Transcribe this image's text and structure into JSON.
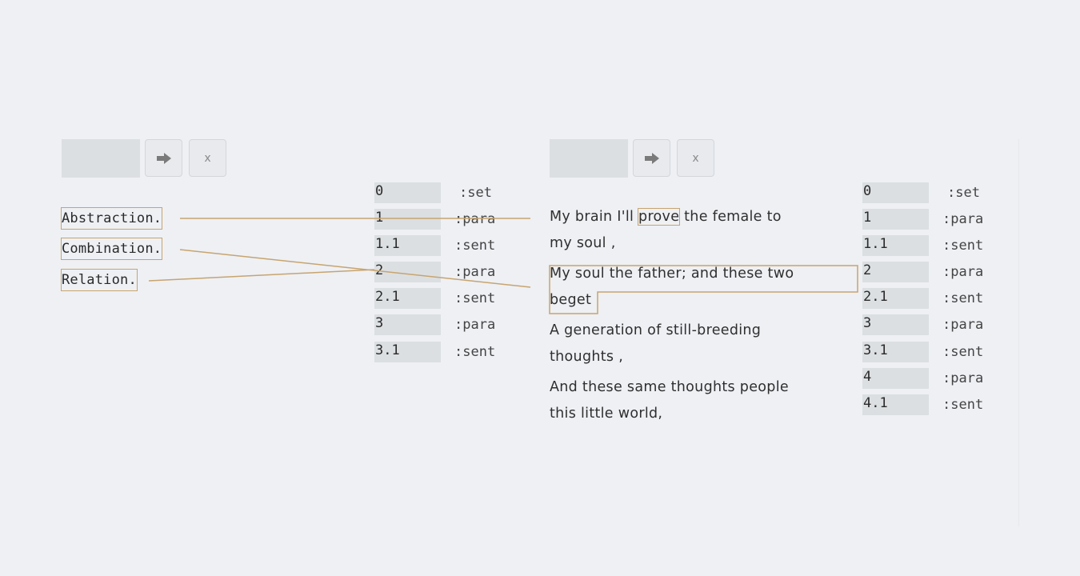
{
  "left_panel": {
    "toolbar": {
      "go_icon": "arrow-right-icon",
      "close_label": "x"
    },
    "words": [
      "Abstraction.",
      "Combination.",
      "Relation."
    ],
    "segments": [
      {
        "id": "0",
        "type": ":set"
      },
      {
        "id": "1",
        "type": ":para"
      },
      {
        "id": "1.1",
        "type": ":sent"
      },
      {
        "id": "2",
        "type": ":para"
      },
      {
        "id": "2.1",
        "type": ":sent"
      },
      {
        "id": "3",
        "type": ":para"
      },
      {
        "id": "3.1",
        "type": ":sent"
      }
    ]
  },
  "right_panel": {
    "toolbar": {
      "go_icon": "arrow-right-icon",
      "close_label": "x"
    },
    "text": {
      "p1_a": "My brain I'll ",
      "p1_hl": "prove",
      "p1_b": " the female to",
      "p1_c": "my soul ,",
      "p2_a": "My soul the father; and these two",
      "p2_b": "beget",
      "p3_a": "A generation of still-breeding",
      "p3_b": "thoughts ,",
      "p4_a": "And these same thoughts people",
      "p4_b": "this little world,"
    },
    "segments": [
      {
        "id": "0",
        "type": ":set"
      },
      {
        "id": "1",
        "type": ":para"
      },
      {
        "id": "1.1",
        "type": ":sent"
      },
      {
        "id": "2",
        "type": ":para"
      },
      {
        "id": "2.1",
        "type": ":sent"
      },
      {
        "id": "3",
        "type": ":para"
      },
      {
        "id": "3.1",
        "type": ":sent"
      },
      {
        "id": "4",
        "type": ":para"
      },
      {
        "id": "4.1",
        "type": ":sent"
      }
    ]
  },
  "colors": {
    "link": "#c7a46f",
    "field": "#dcdfe2",
    "background": "#eef0f4"
  }
}
